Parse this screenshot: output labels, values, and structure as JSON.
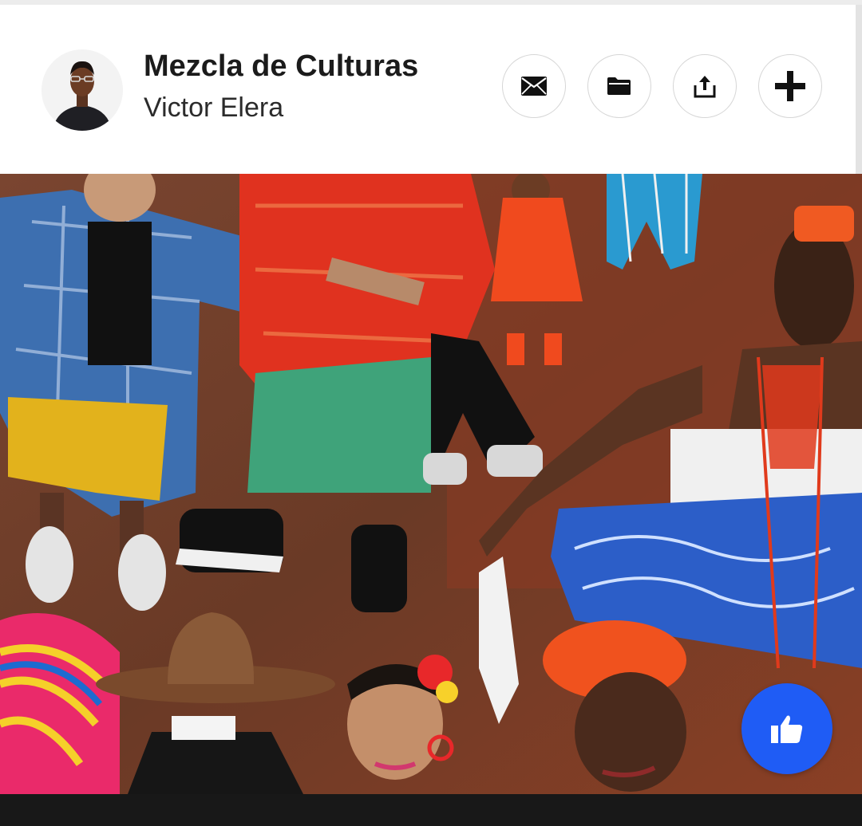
{
  "project": {
    "title": "Mezcla de Culturas",
    "author": "Victor Elera"
  },
  "actions": {
    "message_icon": "envelope-icon",
    "collection_icon": "folder-icon",
    "share_icon": "share-icon",
    "follow_icon": "plus-icon",
    "appreciate_icon": "thumbs-up-icon"
  },
  "colors": {
    "accent": "#1f5cf5",
    "text": "#1b1b1b",
    "border": "#d6d6d6"
  }
}
